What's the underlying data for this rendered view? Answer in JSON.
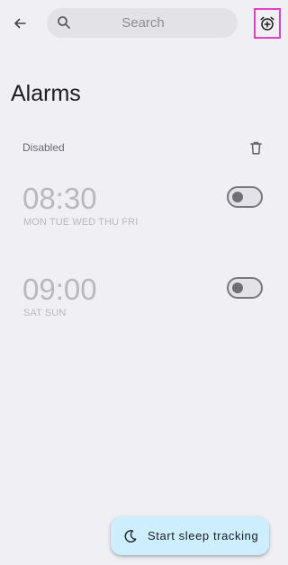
{
  "header": {
    "search_placeholder": "Search"
  },
  "page": {
    "title": "Alarms"
  },
  "section": {
    "label": "Disabled"
  },
  "alarms": [
    {
      "time": "08:30",
      "days": "MON TUE WED THU FRI",
      "enabled": false
    },
    {
      "time": "09:00",
      "days": "SAT SUN",
      "enabled": false
    }
  ],
  "fab": {
    "label": "Start sleep tracking"
  },
  "icons": {
    "back": "arrow-back-icon",
    "search": "search-icon",
    "add_alarm": "alarm-add-icon",
    "delete": "trash-icon",
    "sleep": "moon-icon"
  },
  "colors": {
    "background": "#f0eff4",
    "search_bg": "#e3e2e7",
    "highlight": "#e040c8",
    "disabled_text": "#b8b8bd",
    "fab_bg": "#cdeffd"
  }
}
